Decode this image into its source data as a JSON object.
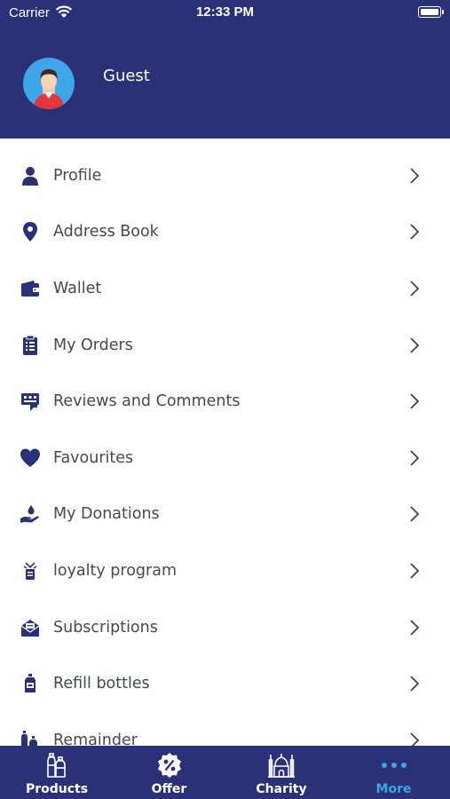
{
  "status_bar": {
    "carrier": "Carrier",
    "time": "12:33 PM"
  },
  "profile": {
    "name": "Guest"
  },
  "menu": {
    "items": [
      {
        "label": "Profile",
        "icon": "person-icon"
      },
      {
        "label": "Address Book",
        "icon": "location-pin-icon"
      },
      {
        "label": "Wallet",
        "icon": "wallet-icon"
      },
      {
        "label": "My Orders",
        "icon": "orders-list-icon"
      },
      {
        "label": "Reviews and Comments",
        "icon": "reviews-icon"
      },
      {
        "label": "Favourites",
        "icon": "heart-icon"
      },
      {
        "label": "My Donations",
        "icon": "donation-hand-icon"
      },
      {
        "label": "loyalty program",
        "icon": "loyalty-icon"
      },
      {
        "label": "Subscriptions",
        "icon": "subscription-envelope-icon"
      },
      {
        "label": "Refill bottles",
        "icon": "refill-bottle-icon"
      },
      {
        "label": "Remainder",
        "icon": "bottles-icon"
      }
    ]
  },
  "tabbar": {
    "tabs": [
      {
        "label": "Products",
        "icon": "bottles-icon",
        "active": false
      },
      {
        "label": "Offer",
        "icon": "percent-badge-icon",
        "active": false
      },
      {
        "label": "Charity",
        "icon": "mosque-icon",
        "active": false
      },
      {
        "label": "More",
        "icon": "more-dots-icon",
        "active": true
      }
    ]
  },
  "colors": {
    "header_bg": "#2b3176",
    "tabbar_bg": "#2b3176",
    "active_tab": "#3aa7e8",
    "icon": "#2b3176",
    "label_text": "#444a52",
    "chevron": "#3b4270"
  }
}
